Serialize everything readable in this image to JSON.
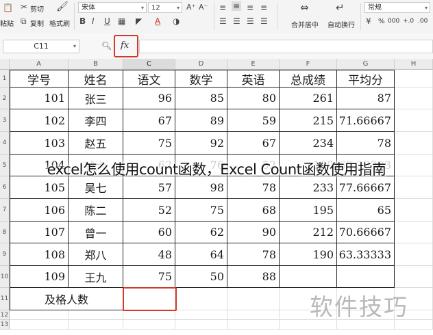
{
  "ribbon": {
    "cut_label": "剪切",
    "copy_label": "复制",
    "paste_label": "粘贴",
    "format_painter_label": "格式刷",
    "font_name": "宋体",
    "font_size": "12",
    "merge_center_label": "合并居中",
    "wrap_text_label": "自动换行",
    "number_format": "常规",
    "percent_symbol": "%",
    "thousands_symbol": "000",
    "inc_decimal_symbol": "+.0",
    "dec_decimal_symbol": ".00"
  },
  "formula_bar": {
    "name_box": "C11",
    "fx_label": "fx",
    "formula": ""
  },
  "columns": [
    "A",
    "B",
    "C",
    "D",
    "E",
    "F",
    "G",
    "H"
  ],
  "selected_column": "C",
  "rows": [
    "1",
    "2",
    "3",
    "4",
    "5",
    "6",
    "7",
    "8",
    "9",
    "10",
    "11",
    "12",
    "13"
  ],
  "table": {
    "headers": [
      "学号",
      "姓名",
      "语文",
      "数学",
      "英语",
      "总成绩",
      "平均分"
    ],
    "data": [
      [
        "101",
        "张三",
        "96",
        "85",
        "80",
        "261",
        "87"
      ],
      [
        "102",
        "李四",
        "67",
        "89",
        "59",
        "215",
        "71.66667"
      ],
      [
        "103",
        "赵五",
        "75",
        "92",
        "67",
        "234",
        "78"
      ],
      [
        "104",
        "钱六",
        "62",
        "76",
        "52",
        "190",
        "63.33333"
      ],
      [
        "105",
        "吴七",
        "57",
        "98",
        "78",
        "233",
        "77.66667"
      ],
      [
        "106",
        "陈二",
        "52",
        "75",
        "68",
        "195",
        "65"
      ],
      [
        "107",
        "曾一",
        "60",
        "62",
        "90",
        "212",
        "70.66667"
      ],
      [
        "108",
        "郑八",
        "48",
        "64",
        "78",
        "190",
        "63.33333"
      ],
      [
        "109",
        "王九",
        "75",
        "50",
        "88",
        "",
        ""
      ]
    ],
    "footer_label": "及格人数"
  },
  "overlay_caption": "excel怎么使用count函数，Excel Count函数使用指南",
  "watermark": "软件技巧",
  "colors": {
    "highlight": "#d13a2a",
    "grid_line": "#dcdcdc",
    "header_bg": "#ececec"
  }
}
